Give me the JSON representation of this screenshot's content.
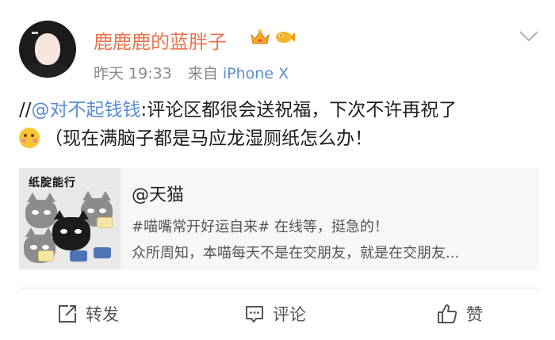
{
  "user": {
    "name": "鹿鹿鹿的蓝胖子",
    "time": "昨天 19:33",
    "source_prefix": "来自",
    "device": "iPhone X"
  },
  "badges": {
    "crown": "crown-badge-icon",
    "fish": "fish-badge-icon"
  },
  "post": {
    "prefix": "//",
    "mention": "@对不起钱钱",
    "text1": ":评论区都很会送祝福，下次不许再祝了",
    "emoji": "smiling-blush-emoji",
    "text2": "（现在满脑子都是马应龙湿厕纸怎么办！"
  },
  "card": {
    "thumb_title": "纸腚能行",
    "title": "@天猫",
    "line1": "#喵嘴常开好运自来# 在线等，挺急的！",
    "line2": "众所周知，本喵每天不是在交朋友，就是在交朋友..."
  },
  "actions": {
    "share": "转发",
    "comment": "评论",
    "like": "赞"
  },
  "colors": {
    "name": "#eb7350",
    "link": "#5a8ed3",
    "meta": "#8a8a8a"
  }
}
